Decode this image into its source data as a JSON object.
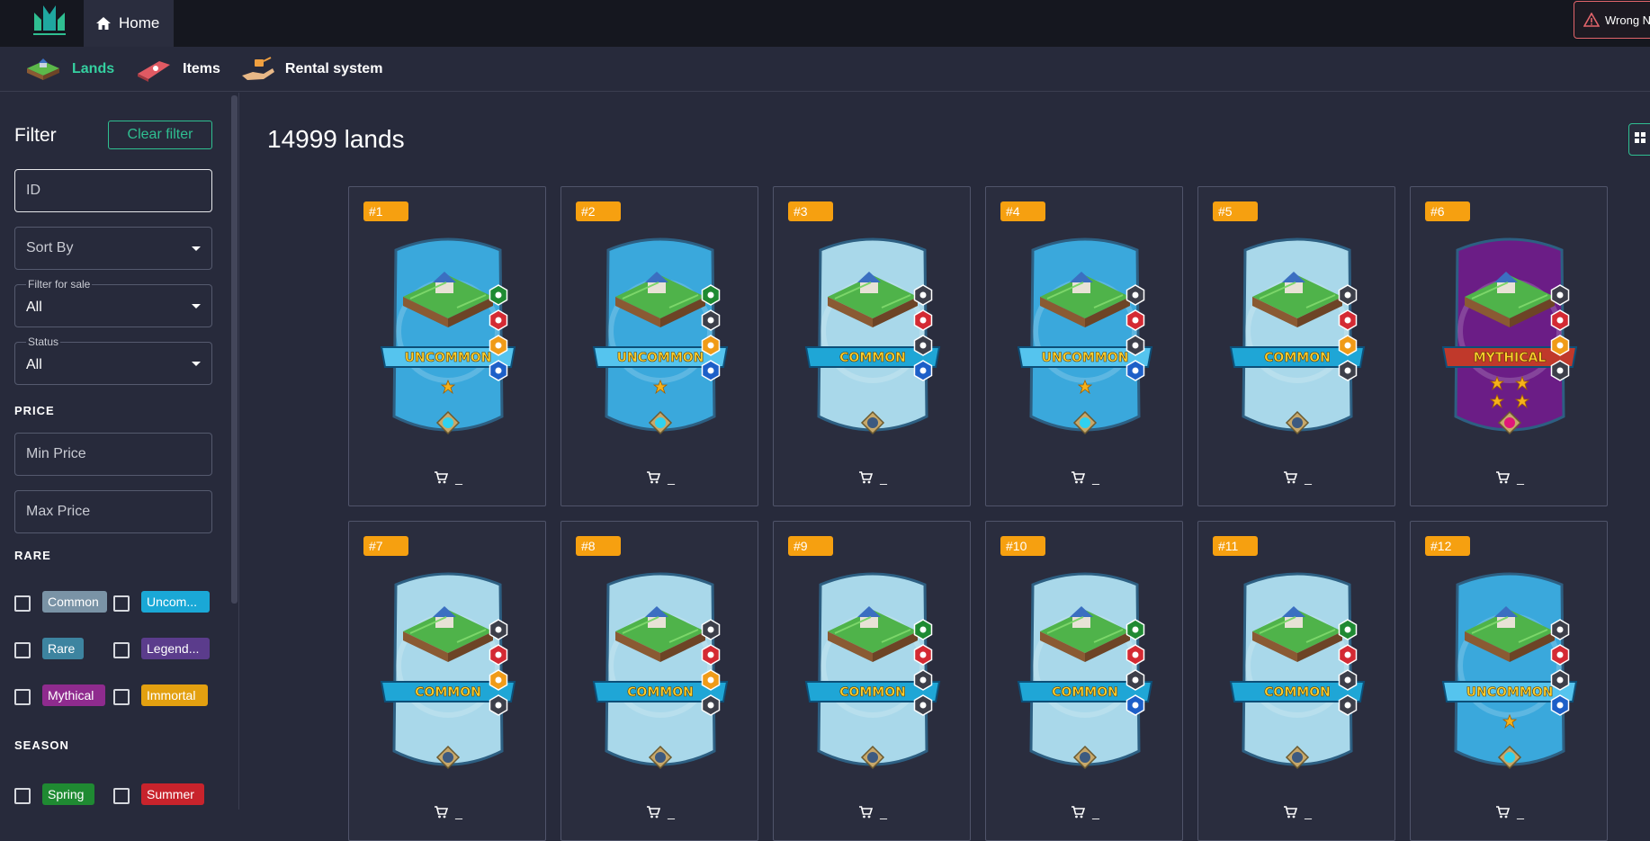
{
  "topbar": {
    "home_label": "Home",
    "warning_text": "Wrong N"
  },
  "nav": {
    "items": [
      {
        "label": "Lands",
        "active": true
      },
      {
        "label": "Items",
        "active": false
      },
      {
        "label": "Rental system",
        "active": false
      }
    ]
  },
  "sidebar": {
    "filter_title": "Filter",
    "clear_filter_label": "Clear filter",
    "id_placeholder": "ID",
    "sort_by_label": "Sort By",
    "filter_for_sale": {
      "label": "Filter for sale",
      "value": "All"
    },
    "status": {
      "label": "Status",
      "value": "All"
    },
    "price_heading": "PRICE",
    "min_price_placeholder": "Min Price",
    "max_price_placeholder": "Max Price",
    "rare_heading": "RARE",
    "rarities": [
      {
        "label": "Common",
        "color": "#7a93a6"
      },
      {
        "label": "Uncom...",
        "color": "#1aa8d6"
      },
      {
        "label": "Rare",
        "color": "#3d84a0"
      },
      {
        "label": "Legend...",
        "color": "#5b3c8c"
      },
      {
        "label": "Mythical",
        "color": "#8f2b8e"
      },
      {
        "label": "Immortal",
        "color": "#e3a010"
      }
    ],
    "season_heading": "SEASON",
    "seasons": [
      {
        "label": "Spring",
        "color": "#1f8a32"
      },
      {
        "label": "Summer",
        "color": "#c8232c"
      }
    ]
  },
  "main": {
    "title": "14999 lands"
  },
  "accent_color": "#35d0a0",
  "cards": [
    {
      "id": "#1",
      "rarity": "UNCOMMON",
      "price": "_",
      "seasons": [
        "spring",
        "summer",
        "autumn",
        "winter"
      ],
      "stars": 1
    },
    {
      "id": "#2",
      "rarity": "UNCOMMON",
      "price": "_",
      "seasons": [
        "spring",
        "off",
        "autumn",
        "winter"
      ],
      "stars": 1
    },
    {
      "id": "#3",
      "rarity": "COMMON",
      "price": "_",
      "seasons": [
        "off",
        "summer",
        "off",
        "winter"
      ],
      "stars": 0
    },
    {
      "id": "#4",
      "rarity": "UNCOMMON",
      "price": "_",
      "seasons": [
        "off",
        "summer",
        "off",
        "winter"
      ],
      "stars": 1
    },
    {
      "id": "#5",
      "rarity": "COMMON",
      "price": "_",
      "seasons": [
        "off",
        "summer",
        "autumn",
        "off"
      ],
      "stars": 0
    },
    {
      "id": "#6",
      "rarity": "MYTHICAL",
      "price": "_",
      "seasons": [
        "off",
        "summer",
        "autumn",
        "off"
      ],
      "stars": 4
    },
    {
      "id": "#7",
      "rarity": "COMMON",
      "price": "_",
      "seasons": [
        "off",
        "summer",
        "autumn",
        "off"
      ],
      "stars": 0
    },
    {
      "id": "#8",
      "rarity": "COMMON",
      "price": "_",
      "seasons": [
        "off",
        "summer",
        "autumn",
        "off"
      ],
      "stars": 0
    },
    {
      "id": "#9",
      "rarity": "COMMON",
      "price": "_",
      "seasons": [
        "spring",
        "summer",
        "off",
        "off"
      ],
      "stars": 0
    },
    {
      "id": "#10",
      "rarity": "COMMON",
      "price": "_",
      "seasons": [
        "spring",
        "summer",
        "off",
        "winter"
      ],
      "stars": 0
    },
    {
      "id": "#11",
      "rarity": "COMMON",
      "price": "_",
      "seasons": [
        "spring",
        "summer",
        "off",
        "off"
      ],
      "stars": 0
    },
    {
      "id": "#12",
      "rarity": "UNCOMMON",
      "price": "_",
      "seasons": [
        "off",
        "summer",
        "off",
        "winter"
      ],
      "stars": 1
    }
  ]
}
